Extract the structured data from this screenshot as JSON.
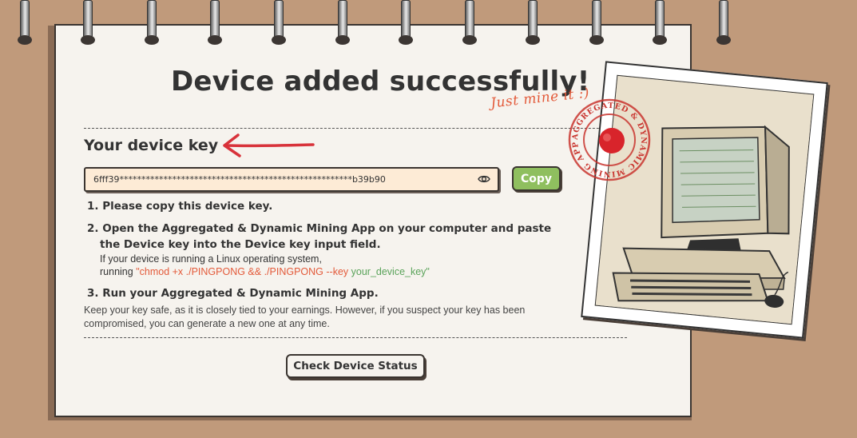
{
  "page": {
    "title": "Device added successfully!",
    "tagline": "Just mine it :)"
  },
  "device_key": {
    "heading": "Your device key",
    "value": "6fff39*****************************************************b39b90",
    "show_icon": "eye-icon",
    "copy_label": "Copy"
  },
  "steps": {
    "s1": "1. Please copy this device key.",
    "s2_line1": "2. Open the Aggregated & Dynamic Mining App on your computer and paste",
    "s2_line2": "the Device key into the Device key input field.",
    "s2_note1": "If your device is running a Linux operating system,",
    "s2_note2_prefix": "running ",
    "s2_cmd": "\"chmod +x ./PINGPONG && ./PINGPONG --key ",
    "s2_cmd_key": "your_device_key\"",
    "s3": "3. Run your Aggregated & Dynamic Mining App."
  },
  "footnote": {
    "line1": "Keep your key safe, as it is closely tied to your earnings. However, if you suspect your key has been",
    "line2": "compromised, you can generate a new one at any time."
  },
  "actions": {
    "check_status": "Check Device Status"
  },
  "stamp": {
    "text": "AGGREGATED & DYNAMIC MINING APP"
  },
  "colors": {
    "background": "#c09a7b",
    "card": "#f6f3ee",
    "accent_red": "#e35a3a",
    "accent_green": "#8fbf5f",
    "key_field": "#fdebd6"
  }
}
